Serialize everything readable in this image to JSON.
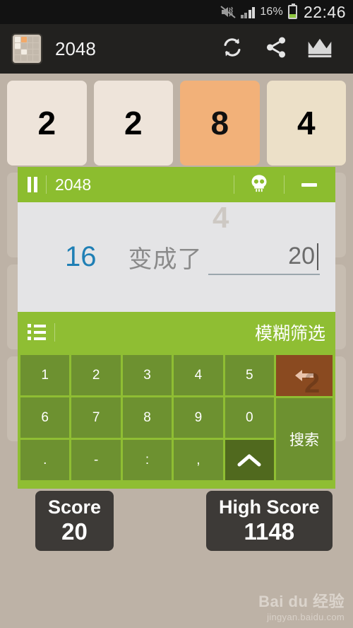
{
  "status_bar": {
    "mute_icon": "mute-speaker-icon",
    "signal_icon": "signal-bars-icon",
    "battery_percent": "16%",
    "battery_icon": "battery-icon",
    "clock": "22:46"
  },
  "action_bar": {
    "app_icon": "app-grid-icon",
    "title": "2048",
    "buttons": [
      {
        "name": "refresh-icon",
        "label": "restart"
      },
      {
        "name": "share-icon",
        "label": "share"
      },
      {
        "name": "crown-icon",
        "label": "high-score"
      }
    ]
  },
  "board": {
    "tiles": [
      {
        "value": "2",
        "class": "t2"
      },
      {
        "value": "2",
        "class": "t2"
      },
      {
        "value": "8",
        "class": "t8"
      },
      {
        "value": "4",
        "class": "t4"
      }
    ],
    "ghost_tile": "4",
    "ghost_key_tile": "2"
  },
  "ime": {
    "header": {
      "pause_icon": "pause-icon",
      "title": "2048",
      "skull_icon": "skull-icon",
      "minimize_icon": "minimize-icon"
    },
    "input": {
      "source_value": "16",
      "label": "变成了",
      "target_value": "20"
    },
    "candidate_bar": {
      "list_icon": "list-icon",
      "filter_label": "模糊筛选"
    },
    "keys_row1": [
      "1",
      "2",
      "3",
      "4",
      "5"
    ],
    "keys_row2": [
      "6",
      "7",
      "8",
      "9",
      "0"
    ],
    "keys_row3": [
      ".",
      "-",
      ":",
      ","
    ],
    "backspace_label": "backspace",
    "search_label": "搜索",
    "shift_label": "shift-up"
  },
  "scores": {
    "score_label": "Score",
    "score_value": "20",
    "high_score_label": "High Score",
    "high_score_value": "1148"
  },
  "watermark": {
    "main": "Bai du 经验",
    "sub": "jingyan.baidu.com"
  },
  "colors": {
    "background": "#bdb2a6",
    "tile": "#eee4da",
    "tile4": "#ece0c8",
    "tile8": "#f2b179",
    "ime_green": "#8fbe33",
    "key_green": "#6d9130",
    "key_dark": "#50691e",
    "backspace_brown": "#8a4a20",
    "accent_blue": "#1f7fb5",
    "score_box": "#3d3a37"
  }
}
